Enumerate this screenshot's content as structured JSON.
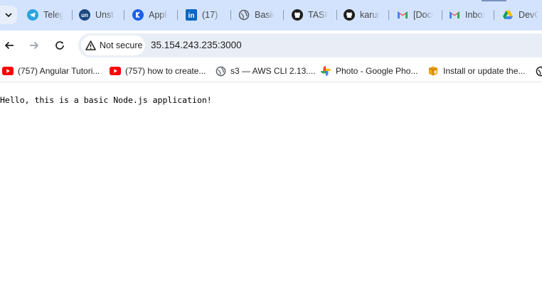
{
  "tabs": [
    {
      "title": "Teleg",
      "icon": "telegram-icon",
      "color": "#2aa3df"
    },
    {
      "title": "Unst",
      "icon": "unstop-icon",
      "color": "#1c4980"
    },
    {
      "title": "Appl",
      "icon": "kodekloud-icon",
      "color": "#1a5ef0"
    },
    {
      "title": "(17)",
      "icon": "linkedin-icon",
      "color": "#0a66c2"
    },
    {
      "title": "Basic",
      "icon": "globe-icon",
      "color": "#5f6368"
    },
    {
      "title": "TASK",
      "icon": "github-icon",
      "color": "#1f1f1f"
    },
    {
      "title": "karun",
      "icon": "github-icon",
      "color": "#1f1f1f"
    },
    {
      "title": "[Dock",
      "icon": "gmail-icon",
      "color": "#ea4335"
    },
    {
      "title": "Inbox",
      "icon": "gmail-icon",
      "color": "#ea4335"
    },
    {
      "title": "DevO",
      "icon": "google-drive-icon",
      "color": "#0f9d58"
    }
  ],
  "toolbar": {
    "security_label": "Not secure",
    "url": "35.154.243.235:3000"
  },
  "bookmarks": [
    {
      "label": "(757) Angular Tutori...",
      "icon": "youtube-icon",
      "color": "#ff0000"
    },
    {
      "label": "(757) how to create...",
      "icon": "youtube-icon",
      "color": "#ff0000"
    },
    {
      "label": "s3 — AWS CLI 2.13....",
      "icon": "globe-icon",
      "color": "#5f6368"
    },
    {
      "label": "Photo - Google Pho...",
      "icon": "google-photos-icon",
      "color": "#fbbc04"
    },
    {
      "label": "Install or update the...",
      "icon": "aws-doc-icon",
      "color": "#f0a30a"
    }
  ],
  "page": {
    "body_text": "Hello, this is a basic Node.js application!"
  },
  "colors": {
    "tabstrip_bg": "#d3e3fd",
    "omnibox_bg": "#e9eef6"
  }
}
